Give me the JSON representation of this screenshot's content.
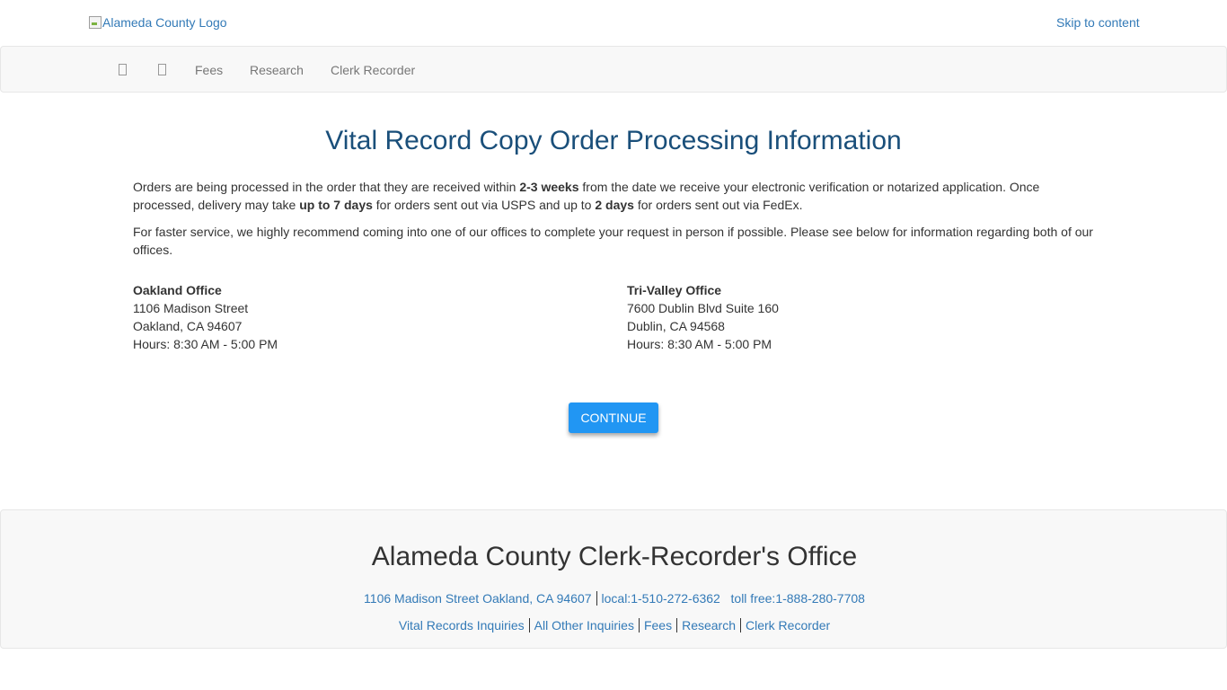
{
  "header": {
    "logo_alt": "Alameda County Logo",
    "skip_link": "Skip to content"
  },
  "nav": {
    "items": [
      {
        "label": "Fees"
      },
      {
        "label": "Research"
      },
      {
        "label": "Clerk Recorder"
      }
    ]
  },
  "main": {
    "title": "Vital Record Copy Order Processing Information",
    "para1": {
      "t1": "Orders are being processed in the order that they are received within ",
      "b1": "2-3 weeks",
      "t2": " from the date we receive your electronic verification or notarized application. Once processed, delivery may take ",
      "b2": "up to 7 days",
      "t3": " for orders sent out via USPS and up to ",
      "b3": "2 days",
      "t4": " for orders sent out via FedEx."
    },
    "para2": "For faster service, we highly recommend coming into one of our offices to complete your request in person if possible. Please see below for information regarding both of our offices.",
    "offices": [
      {
        "name": "Oakland Office",
        "street": "1106 Madison Street",
        "city": "Oakland, CA 94607",
        "hours": "Hours: 8:30 AM - 5:00 PM"
      },
      {
        "name": "Tri-Valley Office",
        "street": "7600 Dublin Blvd Suite 160",
        "city": "Dublin, CA 94568",
        "hours": "Hours: 8:30 AM - 5:00 PM"
      }
    ],
    "continue_label": "CONTINUE"
  },
  "footer": {
    "title": "Alameda County Clerk-Recorder's Office",
    "address": "1106 Madison Street Oakland, CA 94607",
    "local": "local:1-510-272-6362",
    "tollfree": "toll free:1-888-280-7708",
    "links": [
      "Vital Records Inquiries",
      "All Other Inquiries",
      "Fees",
      "Research",
      "Clerk Recorder"
    ]
  },
  "colors": {
    "link": "#337ab7",
    "title": "#1a4f7a",
    "button": "#2196f3",
    "navbar_bg": "#f8f8f8"
  }
}
